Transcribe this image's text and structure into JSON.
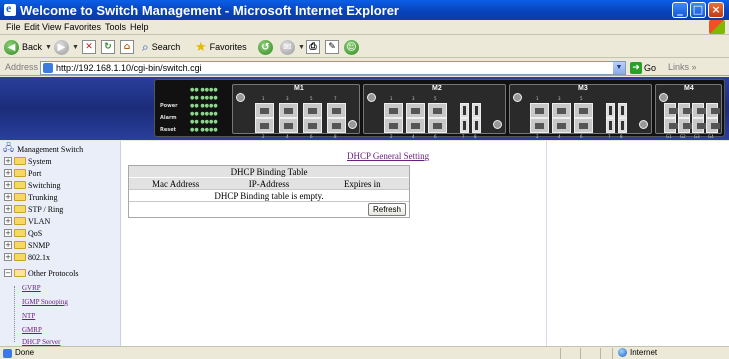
{
  "window": {
    "title": "Welcome to Switch Management - Microsoft Internet Explorer"
  },
  "menu": [
    "File",
    "Edit",
    "View",
    "Favorites",
    "Tools",
    "Help"
  ],
  "toolbar": {
    "back": "Back",
    "search": "Search",
    "favorites": "Favorites"
  },
  "address": {
    "label": "Address",
    "url": "http://192.168.1.10/cgi-bin/switch.cgi",
    "go": "Go",
    "links": "Links"
  },
  "banner": {
    "modules": [
      {
        "title": "M1",
        "ports": [
          "1",
          "2",
          "3",
          "4",
          "5",
          "6",
          "7",
          "8"
        ]
      },
      {
        "title": "M2",
        "ports": [
          "1",
          "2",
          "3",
          "4",
          "5",
          "6",
          "7",
          "8"
        ]
      },
      {
        "title": "M3",
        "ports": [
          "1",
          "2",
          "3",
          "4",
          "5",
          "6",
          "7",
          "8"
        ]
      },
      {
        "title": "M4",
        "ports": [
          "G1",
          "G2",
          "G3",
          "G4"
        ]
      }
    ],
    "led_labels": [
      "Power",
      "Alarm",
      "Reset"
    ]
  },
  "sidebar": {
    "root": "Management Switch",
    "folders": [
      "System",
      "Port",
      "Switching",
      "Trunking",
      "STP / Ring",
      "VLAN",
      "QoS",
      "SNMP",
      "802.1x",
      "Other Protocols"
    ],
    "sublinks": [
      "GVRP",
      "IGMP Snooping",
      "NTP",
      "GMRP",
      "DHCP Server"
    ]
  },
  "main": {
    "general_link": "DHCP General Setting",
    "table_title": "DHCP Binding Table",
    "columns": [
      "Mac Address",
      "IP-Address",
      "Expires in"
    ],
    "empty_message": "DHCP Binding table is empty.",
    "refresh_label": "Refresh"
  },
  "status": {
    "text": "Done",
    "zone": "Internet"
  }
}
